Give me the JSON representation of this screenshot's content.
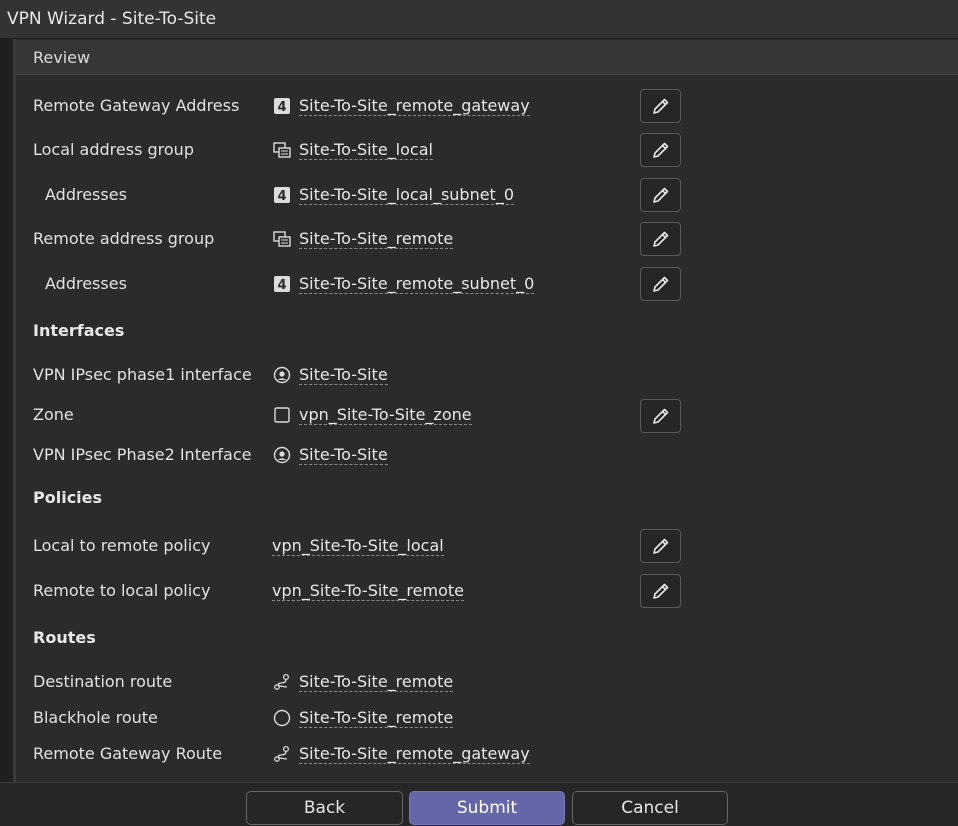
{
  "window": {
    "title": "VPN Wizard - Site-To-Site"
  },
  "section": {
    "title": "Review"
  },
  "colors": {
    "accent": "#6466a8",
    "background": "#2b2b2b",
    "text": "#e6e6e6"
  },
  "rows": {
    "remote_gateway": {
      "label": "Remote Gateway Address",
      "value": "Site-To-Site_remote_gateway",
      "icon": "ipv4-address-icon"
    },
    "local_group": {
      "label": "Local address group",
      "value": "Site-To-Site_local",
      "icon": "address-group-icon"
    },
    "local_addresses": {
      "label": "Addresses",
      "value": "Site-To-Site_local_subnet_0",
      "icon": "ipv4-address-icon"
    },
    "remote_group": {
      "label": "Remote address group",
      "value": "Site-To-Site_remote",
      "icon": "address-group-icon"
    },
    "remote_addresses": {
      "label": "Addresses",
      "value": "Site-To-Site_remote_subnet_0",
      "icon": "ipv4-address-icon"
    }
  },
  "interfaces": {
    "title": "Interfaces",
    "phase1": {
      "label": "VPN IPsec phase1 interface",
      "value": "Site-To-Site",
      "icon": "tunnel-interface-icon"
    },
    "zone": {
      "label": "Zone",
      "value": "vpn_Site-To-Site_zone",
      "icon": "zone-icon"
    },
    "phase2": {
      "label": "VPN IPsec Phase2 Interface",
      "value": "Site-To-Site",
      "icon": "tunnel-interface-icon"
    }
  },
  "policies": {
    "title": "Policies",
    "local_to_remote": {
      "label": "Local to remote policy",
      "value": "vpn_Site-To-Site_local"
    },
    "remote_to_local": {
      "label": "Remote to local policy",
      "value": "vpn_Site-To-Site_remote"
    }
  },
  "routes": {
    "title": "Routes",
    "destination": {
      "label": "Destination route",
      "value": "Site-To-Site_remote",
      "icon": "route-icon"
    },
    "blackhole": {
      "label": "Blackhole route",
      "value": "Site-To-Site_remote",
      "icon": "blackhole-icon"
    },
    "gateway": {
      "label": "Remote Gateway Route",
      "value": "Site-To-Site_remote_gateway",
      "icon": "route-icon"
    }
  },
  "footer": {
    "back": "Back",
    "submit": "Submit",
    "cancel": "Cancel"
  }
}
